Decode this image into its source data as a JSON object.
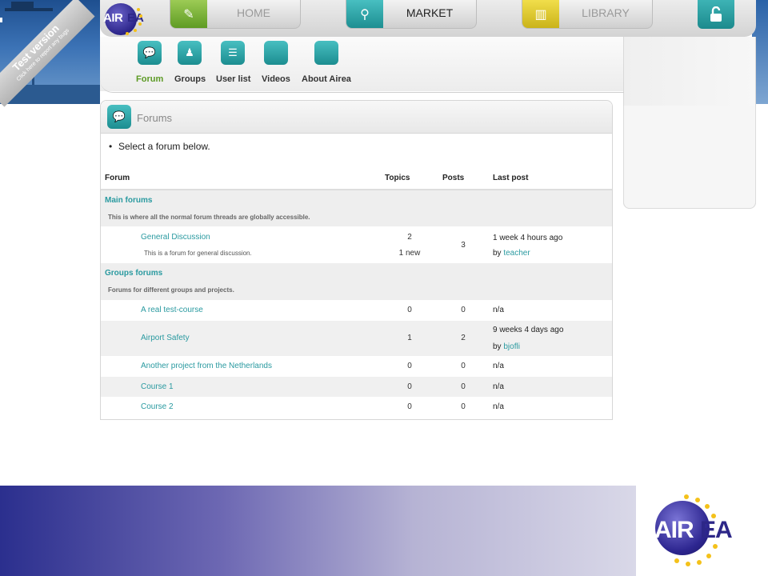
{
  "banner": {
    "line1": "Test version",
    "line2": "Click here to report any bugs"
  },
  "logo": {
    "text_white": "AIR",
    "text_dark": "EA"
  },
  "nav": {
    "home": "HOME",
    "market": "MARKET",
    "library": "LIBRARY"
  },
  "subnav": [
    {
      "label": "Forum",
      "icon": "forum-icon"
    },
    {
      "label": "Groups",
      "icon": "groups-icon"
    },
    {
      "label": "User list",
      "icon": "user-list-icon"
    },
    {
      "label": "Videos",
      "icon": "videos-icon"
    },
    {
      "label": "About Airea",
      "icon": "about-icon"
    }
  ],
  "forums": {
    "title": "Forums",
    "intro": "Select a forum below.",
    "columns": {
      "forum": "Forum",
      "topics": "Topics",
      "posts": "Posts",
      "last_post": "Last post"
    },
    "main": {
      "name": "Main forums",
      "desc": "This is where all the normal forum threads are globally accessible.",
      "forum": {
        "name": "General Discussion",
        "desc": "This is a forum for general discussion.",
        "topics": "2",
        "new": "1 new",
        "posts": "3",
        "last_time": "1 week 4 hours ago",
        "by": "by",
        "last_user": "teacher"
      }
    },
    "groups": {
      "name": "Groups forums",
      "desc": "Forums for different groups and projects.",
      "rows": [
        {
          "name": "A real test-course",
          "topics": "0",
          "posts": "0",
          "last": "n/a"
        },
        {
          "name": "Airport Safety",
          "topics": "1",
          "posts": "2",
          "last_time": "9 weeks 4 days ago",
          "by": "by",
          "last_user": "bjofli"
        },
        {
          "name": "Another project from the Netherlands",
          "topics": "0",
          "posts": "0",
          "last": "n/a"
        },
        {
          "name": "Course 1",
          "topics": "0",
          "posts": "0",
          "last": "n/a"
        },
        {
          "name": "Course 2",
          "topics": "0",
          "posts": "0",
          "last": "n/a"
        }
      ]
    }
  },
  "footer_logo": {
    "text_white": "AIR",
    "text_dark": "EA"
  }
}
